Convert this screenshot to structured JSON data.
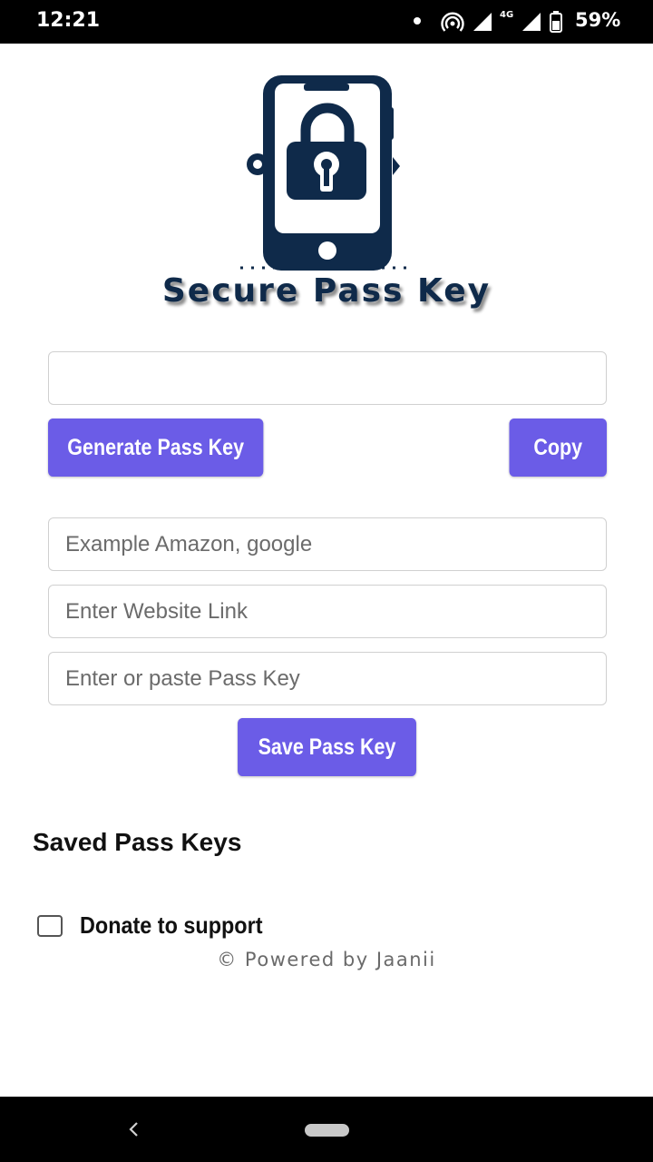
{
  "status_bar": {
    "time": "12:21",
    "network": "4G",
    "battery": "59%"
  },
  "app": {
    "title": "Secure Pass Key",
    "generated_key": {
      "value": "",
      "placeholder": ""
    },
    "generate_button": "Generate Pass Key",
    "copy_button": "Copy",
    "name_field": {
      "value": "",
      "placeholder": "Example Amazon, google"
    },
    "link_field": {
      "value": "",
      "placeholder": "Enter Website Link"
    },
    "key_field": {
      "value": "",
      "placeholder": "Enter or paste Pass Key"
    },
    "save_button": "Save Pass Key",
    "saved_heading": "Saved Pass Keys",
    "donate_label": "Donate to support",
    "donate_checked": false,
    "powered_by": "© Powered by Jaanii"
  },
  "colors": {
    "accent": "#6b5ce7",
    "logo_navy": "#0f2a4a"
  },
  "icons": {
    "logo": "phone-padlock-icon",
    "back": "back-chevron-icon",
    "home": "home-pill-icon"
  }
}
